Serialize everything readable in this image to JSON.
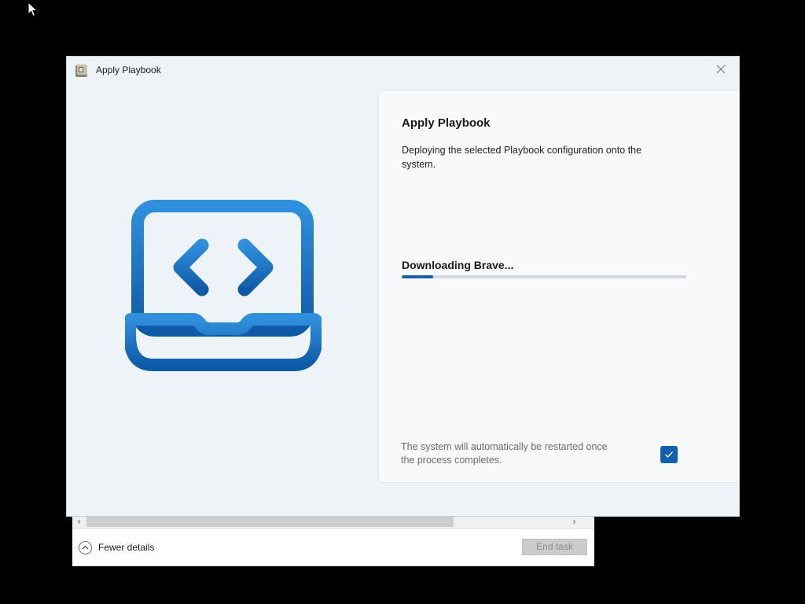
{
  "window": {
    "title": "Apply Playbook",
    "app_icon": "playbook-app-icon",
    "close_icon": "close-icon"
  },
  "hero": {
    "icon": "laptop-code-icon",
    "color": "#1565c0"
  },
  "main": {
    "heading": "Apply Playbook",
    "description": "Deploying the selected Playbook configuration onto the system.",
    "status": "Downloading Brave...",
    "progress_percent": 11,
    "restart_note": "The system will automatically be restarted once the process completes.",
    "restart_checkbox_checked": true,
    "accent_color": "#1160b2"
  },
  "task_manager": {
    "fewer_details_label": "Fewer details",
    "end_task_label": "End task"
  }
}
